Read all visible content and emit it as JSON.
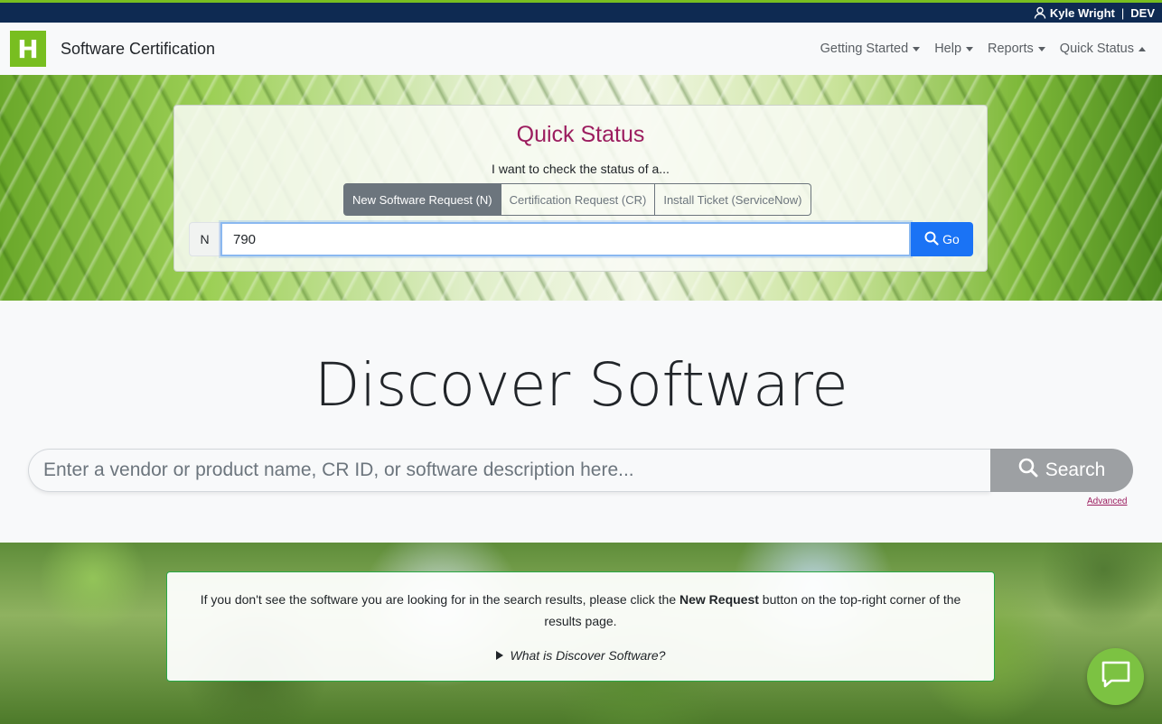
{
  "topbar": {
    "user_name": "Kyle Wright",
    "separator": "|",
    "env": "DEV"
  },
  "navbar": {
    "logo_letter": "H",
    "brand": "Software Certification",
    "menu": [
      {
        "label": "Getting Started",
        "caret": "down"
      },
      {
        "label": "Help",
        "caret": "down"
      },
      {
        "label": "Reports",
        "caret": "down"
      },
      {
        "label": "Quick Status",
        "caret": "up"
      }
    ]
  },
  "quick_status": {
    "title": "Quick Status",
    "subtitle": "I want to check the status of a...",
    "tabs": [
      {
        "label": "New Software Request (N)",
        "active": true
      },
      {
        "label": "Certification Request (CR)",
        "active": false
      },
      {
        "label": "Install Ticket (ServiceNow)",
        "active": false
      }
    ],
    "prefix": "N",
    "input_value": "790",
    "go_label": "Go"
  },
  "discover": {
    "title": "Discover Software",
    "search_placeholder": "Enter a vendor or product name, CR ID, or software description here...",
    "search_label": "Search",
    "advanced_label": "Advanced"
  },
  "info": {
    "text_before": "If you don't see the software you are looking for in the search results, please click the ",
    "text_bold": "New Request",
    "text_after": " button on the top-right corner of the results page.",
    "details_label": "What is Discover Software?"
  },
  "colors": {
    "brand_green": "#78be20",
    "topbar_navy": "#0e2a52",
    "accent_magenta": "#9c1d5f",
    "go_blue": "#1a73f5",
    "search_gray": "#9da0a3",
    "chat_green": "#7cc242"
  },
  "icons": {
    "user": "user-icon",
    "go": "search-icon",
    "search": "search-icon",
    "details": "triangle-right-icon",
    "chat": "chat-bubble-icon"
  }
}
